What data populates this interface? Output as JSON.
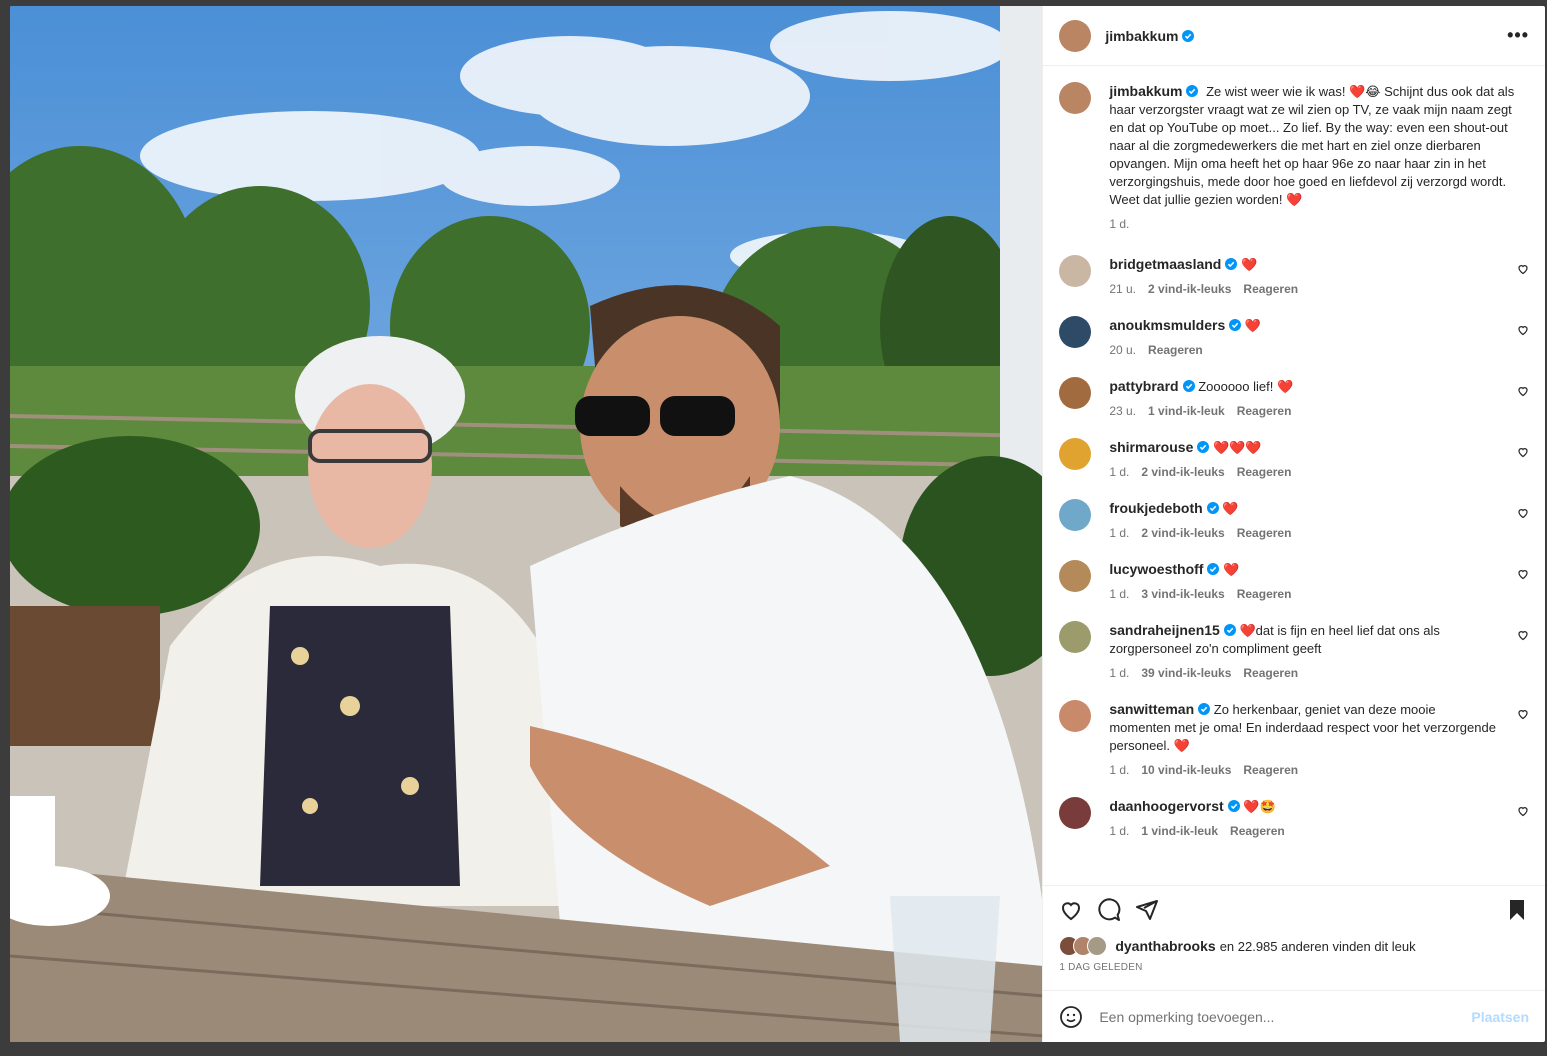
{
  "post": {
    "author": "jimbakkum",
    "caption": {
      "text": "Ze wist weer wie ik was! ❤️😂 Schijnt dus ook dat als haar verzorgster vraagt wat ze wil zien op TV, ze vaak mijn naam zegt en dat op YouTube op moet... Zo lief. By the way: even een shout-out naar al die zorgmedewerkers die met hart en ziel onze dierbaren opvangen. Mijn oma heeft het op haar 96e zo naar haar zin in het verzorgingshuis, mede door hoe goed en liefdevol zij verzorgd wordt. Weet dat jullie gezien worden! ❤️",
      "time": "1 d."
    },
    "comments": [
      {
        "user": "bridgetmaasland",
        "text": "❤️",
        "time": "21 u.",
        "likes": "2 vind-ik-leuks",
        "reply": "Reageren",
        "avatar": "#c9b7a4"
      },
      {
        "user": "anoukmsmulders",
        "text": "❤️",
        "time": "20 u.",
        "likes": "",
        "reply": "Reageren",
        "avatar": "#2d4b66"
      },
      {
        "user": "pattybrard",
        "text": "Zoooooo lief! ❤️",
        "time": "23 u.",
        "likes": "1 vind-ik-leuk",
        "reply": "Reageren",
        "avatar": "#a26b3f"
      },
      {
        "user": "shirmarouse",
        "text": "❤️❤️❤️",
        "time": "1 d.",
        "likes": "2 vind-ik-leuks",
        "reply": "Reageren",
        "avatar": "#e0a32f"
      },
      {
        "user": "froukjedeboth",
        "text": "❤️",
        "time": "1 d.",
        "likes": "2 vind-ik-leuks",
        "reply": "Reageren",
        "avatar": "#6fa8c9"
      },
      {
        "user": "lucywoesthoff",
        "text": "❤️",
        "time": "1 d.",
        "likes": "3 vind-ik-leuks",
        "reply": "Reageren",
        "avatar": "#b58a5a"
      },
      {
        "user": "sandraheijnen15",
        "text": "❤️dat is fijn en heel lief dat ons als zorgpersoneel zo'n compliment geeft",
        "time": "1 d.",
        "likes": "39 vind-ik-leuks",
        "reply": "Reageren",
        "avatar": "#9b9b6b"
      },
      {
        "user": "sanwitteman",
        "text": "Zo herkenbaar, geniet van deze mooie momenten met je oma! En inderdaad respect voor het verzorgende personeel. ❤️",
        "time": "1 d.",
        "likes": "10 vind-ik-leuks",
        "reply": "Reageren",
        "avatar": "#c88a6a"
      },
      {
        "user": "daanhoogervorst",
        "text": "❤️🤩",
        "time": "1 d.",
        "likes": "1 vind-ik-leuk",
        "reply": "Reageren",
        "avatar": "#7a3b3b"
      }
    ],
    "liked_by": "dyanthabrooks",
    "likes_suffix": "en 22.985 anderen vinden dit leuk",
    "date": "1 DAG GELEDEN",
    "composer": {
      "placeholder": "Een opmerking toevoegen...",
      "post_label": "Plaatsen"
    },
    "colors": {
      "accent": "#0095f6",
      "heart": "#e0173a",
      "verified": "#0095f6"
    }
  }
}
